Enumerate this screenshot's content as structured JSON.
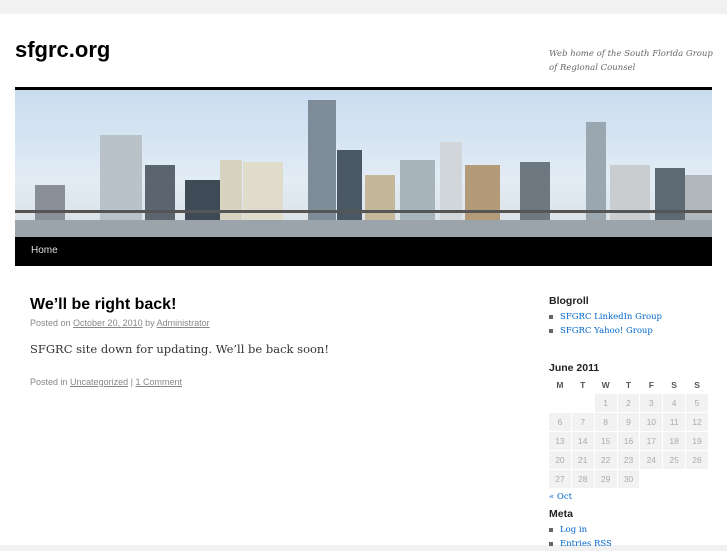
{
  "site": {
    "title": "sfgrc.org",
    "description": "Web home of the South Florida Group of Regional Counsel"
  },
  "nav": {
    "home": "Home"
  },
  "post": {
    "title": "We’ll be right back!",
    "posted_on": "Posted on",
    "date": "October 20, 2010",
    "by": "by",
    "author": "Administrator",
    "body": "SFGRC site down for updating. We’ll be back soon!",
    "posted_in": "Posted in",
    "category": "Uncategorized",
    "sep": "|",
    "comments": "1 Comment"
  },
  "blogroll": {
    "title": "Blogroll",
    "links": [
      "SFGRC LinkedIn Group",
      "SFGRC Yahoo! Group"
    ]
  },
  "calendar": {
    "title": "June 2011",
    "days": [
      "M",
      "T",
      "W",
      "T",
      "F",
      "S",
      "S"
    ],
    "weeks": [
      [
        "",
        "",
        "1",
        "2",
        "3",
        "4",
        "5"
      ],
      [
        "6",
        "7",
        "8",
        "9",
        "10",
        "11",
        "12"
      ],
      [
        "13",
        "14",
        "15",
        "16",
        "17",
        "18",
        "19"
      ],
      [
        "20",
        "21",
        "22",
        "23",
        "24",
        "25",
        "26"
      ],
      [
        "27",
        "28",
        "29",
        "30",
        "",
        "",
        ""
      ]
    ],
    "prev": "« Oct"
  },
  "meta": {
    "title": "Meta",
    "links": [
      "Log in",
      "Entries RSS"
    ]
  }
}
